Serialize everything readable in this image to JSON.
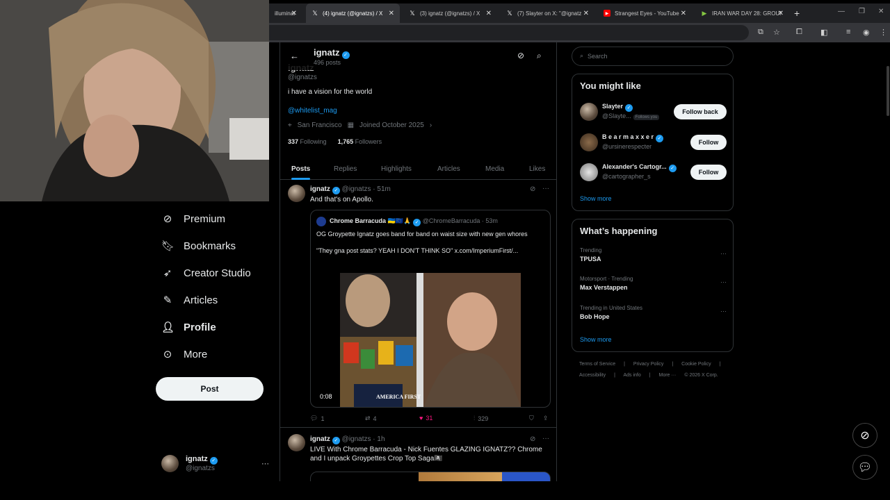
{
  "browser": {
    "tabs": [
      {
        "label": "illuminat",
        "icon": "tab-icon"
      },
      {
        "label": "(4) ignatz (@ignatzs) / X",
        "icon": "x-logo-icon"
      },
      {
        "label": "(3) ignatz (@ignatzs) / X",
        "icon": "x-logo-icon"
      },
      {
        "label": "(7) Slayter on X: \"@ignatz",
        "icon": "x-logo-icon"
      },
      {
        "label": "Strangest Eyes - YouTube",
        "icon": "youtube-icon"
      },
      {
        "label": "IRAN WAR DAY 28: GROUN",
        "icon": "rumble-icon"
      }
    ],
    "new_tab_icon": "plus-icon"
  },
  "nav": {
    "items": [
      {
        "label": "Premium",
        "icon": "premium-icon"
      },
      {
        "label": "Bookmarks",
        "icon": "bookmark-icon"
      },
      {
        "label": "Creator Studio",
        "icon": "rocket-icon"
      },
      {
        "label": "Articles",
        "icon": "article-icon"
      },
      {
        "label": "Profile",
        "icon": "person-icon"
      },
      {
        "label": "More",
        "icon": "more-circle-icon"
      }
    ],
    "post_label": "Post",
    "account": {
      "name": "ignatz",
      "handle": "@ignatzs"
    }
  },
  "profile": {
    "header_name": "ignatz",
    "post_count": "496 posts",
    "name": "ignatz",
    "handle": "@ignatzs",
    "bio": "i have a vision for the world",
    "link": "@whitelist_mag",
    "location": "San Francisco",
    "joined": "Joined October 2025",
    "following_count": "337",
    "following_label": "Following",
    "followers_count": "1,765",
    "followers_label": "Followers",
    "tabs": [
      "Posts",
      "Replies",
      "Highlights",
      "Articles",
      "Media",
      "Likes"
    ],
    "active_tab": "Posts"
  },
  "tweets": [
    {
      "name": "ignatz",
      "handle": "@ignatzs",
      "time": "51m",
      "text": "And that's on Apollo.",
      "quote": {
        "name": "Chrome Barracuda",
        "flags": "🇺🇦🇪🇺🙏",
        "handle": "@ChromeBarracuda",
        "time": "53m",
        "text_1": "OG Groypette Ignatz goes band for band on waist size with new gen whores",
        "text_2": "\"They gna post stats? YEAH I DON'T THINK SO\"  x.com/ImperiumFirst/...",
        "duration": "0:08",
        "hat_text": "AMERICA FIRST"
      },
      "replies": "1",
      "reposts": "4",
      "likes": "31",
      "views": "329"
    },
    {
      "name": "ignatz",
      "handle": "@ignatzs",
      "time": "1h",
      "text": "LIVE With Chrome Barracuda - Nick Fuentes GLAZING IGNATZ?? Chrome and I unpack Groypettes Crop Top Saga🏴‍☠️"
    }
  ],
  "sidebar": {
    "search_placeholder": "Search",
    "you_might_like": {
      "title": "You might like",
      "users": [
        {
          "name": "Slayter",
          "handle": "@Slayte...",
          "follows_you": "Follows you",
          "button": "Follow back"
        },
        {
          "name": "B e a r m a x x e r",
          "handle": "@ursinerespecter",
          "button": "Follow"
        },
        {
          "name": "Alexander's Cartogr...",
          "handle": "@cartographer_s",
          "button": "Follow"
        }
      ],
      "show_more": "Show more"
    },
    "whats_happening": {
      "title": "What’s happening",
      "trends": [
        {
          "context": "Trending",
          "topic": "TPUSA"
        },
        {
          "context": "Motorsport · Trending",
          "topic": "Max Verstappen"
        },
        {
          "context": "Trending in United States",
          "topic": "Bob Hope"
        }
      ],
      "show_more": "Show more"
    },
    "footer": {
      "line1": [
        "Terms of Service",
        "|",
        "Privacy Policy",
        "|",
        "Cookie Policy",
        "|"
      ],
      "line2": [
        "Accessibility",
        "|",
        "Ads info",
        "|",
        "More ···",
        "© 2026 X Corp."
      ]
    }
  }
}
